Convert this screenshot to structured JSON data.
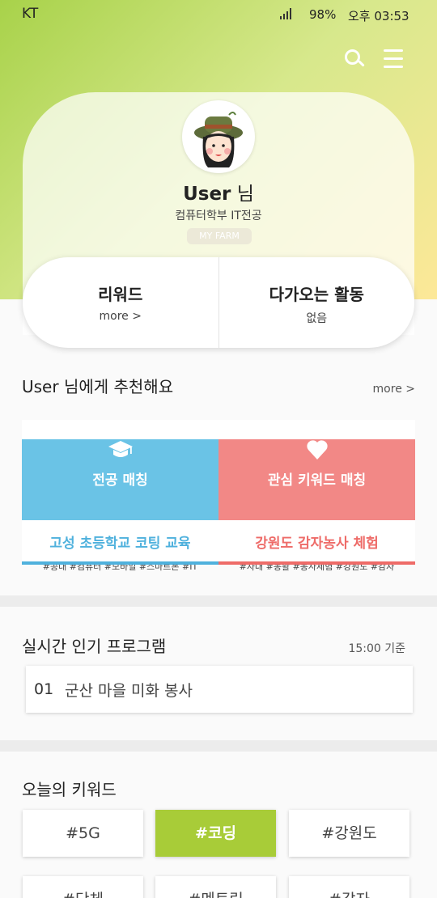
{
  "status": {
    "carrier": "KT",
    "battery": "98%",
    "time": "오후 03:53"
  },
  "profile": {
    "name": "User",
    "name_suffix": " 님",
    "major": "컴퓨터학부 IT전공",
    "badge": "MY FARM"
  },
  "stats": {
    "reward": {
      "title": "리워드",
      "sub": "more >"
    },
    "upcoming": {
      "title": "다가오는 활동",
      "sub": "없음"
    }
  },
  "recommend": {
    "heading": "User 님에게 추천해요",
    "more": "more >",
    "major_match": {
      "label": "전공 매칭",
      "icon": "graduation-cap-icon",
      "color": "#6ac3e6",
      "program": "고성 초등학교 코팅 교육",
      "program_color": "#4fb1dd",
      "tags": "#공대 #컴퓨터 #모바일 #스마트폰 #IT"
    },
    "keyword_match": {
      "label": "관심 키워드 매칭",
      "icon": "heart-icon",
      "color": "#f28886",
      "program": "강원도 감자농사 체험",
      "program_color": "#ee6b68",
      "tags": "#자대 #농활 #농사체험 #강원도 #감자"
    }
  },
  "popular": {
    "heading": "실시간 인기 프로그램",
    "time": "15:00 기준",
    "items": [
      {
        "rank": "01",
        "title": "군산 마을 미화 봉사"
      }
    ]
  },
  "keywords": {
    "heading": "오늘의 키워드",
    "items": [
      "#5G",
      "#코딩",
      "#강원도",
      "#단체",
      "#멘토링",
      "#감자"
    ],
    "active_index": 1,
    "accent": "#a8cc38"
  }
}
